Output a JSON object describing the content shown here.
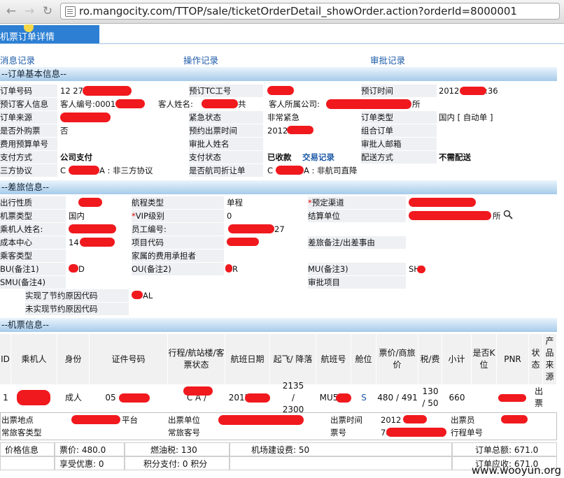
{
  "browser": {
    "url": "ro.mangocity.com/TTOP/sale/ticketOrderDetail_showOrder.action?orderId=8000001"
  },
  "page": {
    "title": "机票订单详情",
    "links": {
      "messages": "消息记录",
      "operations": "操作记录",
      "approvals": "审批记录"
    }
  },
  "sections": {
    "basic": "--订单基本信息--",
    "travel": "--差旅信息--",
    "ticket": "--机票信息--"
  },
  "basic": {
    "order_no_label": "订单号码",
    "order_no": "12  272",
    "booking_tc_label": "预订TC工号",
    "booking_time_label": "预订时间",
    "booking_time": "2012       10:20:36",
    "customer_label": "预订客人信息",
    "customer_no": "客人编号:0001",
    "customer_name_label": "客人姓名:",
    "customer_name_tail": "共",
    "company_label": "客人所属公司:",
    "company_tail": "所",
    "source_label": "订单来源",
    "urgency_label": "紧急状态",
    "urgency": "非常紧急",
    "order_type_label": "订单类型",
    "order_type": "国内 [ 自动单 ]",
    "outsourced_label": "是否外购票",
    "outsourced": "否",
    "issue_time_label": "预约出票时间",
    "issue_time": "2012          19:20",
    "combo_label": "组合订单",
    "budget_label": "费用预算单号",
    "approver_label": "审批人姓名",
    "approver_email_label": "审批人邮箱",
    "pay_label": "支付方式",
    "pay": "公司支付",
    "pay_status_label": "支付状态",
    "pay_status": "已收款",
    "transactions": "交易记录",
    "delivery_label": "配送方式",
    "delivery": "不需配送",
    "third_party_label": "三方协议",
    "third_party_prefix": "C",
    "third_party": "A : 非三方协议",
    "discount_label": "是否航司折让单",
    "discount_prefix": "C",
    "discount": "A : 非航司直降"
  },
  "travel": {
    "nature_label": "出行性质",
    "route_type_label": "航程类型",
    "route_type": "单程",
    "channel_label": "预定渠道",
    "channel_star": "*",
    "ticket_type_label": "机票类型",
    "ticket_type": "国内",
    "vip_label": "VIP级别",
    "vip_star": "*",
    "vip": "0",
    "settle_label": "结算单位",
    "settle_tail": "所",
    "passenger_label": "乘机人姓名:",
    "employee_label": "员工编号:",
    "employee_tail": "27",
    "cost_center_label": "成本中心",
    "cost_center": "14",
    "project_label": "项目代码",
    "trip_note_label": "差旅备注/出差事由",
    "guest_type_label": "乘客类型",
    "family_label": "家属的费用承担者",
    "bu_label": "BU(备注1)",
    "bu": "D",
    "ou_label": "OU(备注2)",
    "ou": "R",
    "mu_label": "MU(备注3)",
    "mu": "SH",
    "smu_label": "SMU(备注4)",
    "approval_item_label": "审批项目",
    "saving_label": "实现了节约原因代码",
    "saving": "AL",
    "nosaving_label": "未实现节约原因代码"
  },
  "ticket_table": {
    "headers": [
      "ID",
      "乘机人",
      "身份",
      "证件号码",
      "行程/航站楼/客票状态",
      "航班日期",
      "起飞/ 降落",
      "航班号",
      "舱位",
      "票价/商旅价",
      "税/费",
      "小计",
      "是否K位",
      "PNR",
      "状态",
      "产品来源"
    ],
    "row": {
      "id": "1",
      "identity": "成人",
      "cert": "05",
      "route": "C          A /",
      "date": "2012/",
      "times": "2135 / 2300",
      "flight": "MU5",
      "cabin": "S",
      "price": "480 / 491",
      "tax": "130 / 50",
      "subtotal": "660",
      "status": "出票"
    }
  },
  "issue": {
    "place_label": "出票地点",
    "place_tail": "平台",
    "unit_label": "出票单位",
    "time_label": "出票时间",
    "time": "2012",
    "clerk_label": "出票员",
    "ff_type_label": "常旅客类型",
    "ff_no_label": "常旅客号",
    "ticket_no_label": "票号",
    "ticket_no": "78",
    "itinerary_label": "行程单号"
  },
  "price": {
    "label": "价格信息",
    "fare": "票价: 480.0",
    "fuel": "燃油税: 130",
    "airport": "机场建设费: 50",
    "total": "订单总额: 671.0",
    "discount": "享受优惠: 0",
    "points": "积分支付: 0 积分",
    "receivable": "订单应收: 671.0"
  },
  "watermark": "www.wooyun.org",
  "colors": {
    "section_bg": "#a6cbea",
    "link": "#1c5aa7",
    "redaction": "#f0191e",
    "title_tab": "#2c7fd3"
  }
}
